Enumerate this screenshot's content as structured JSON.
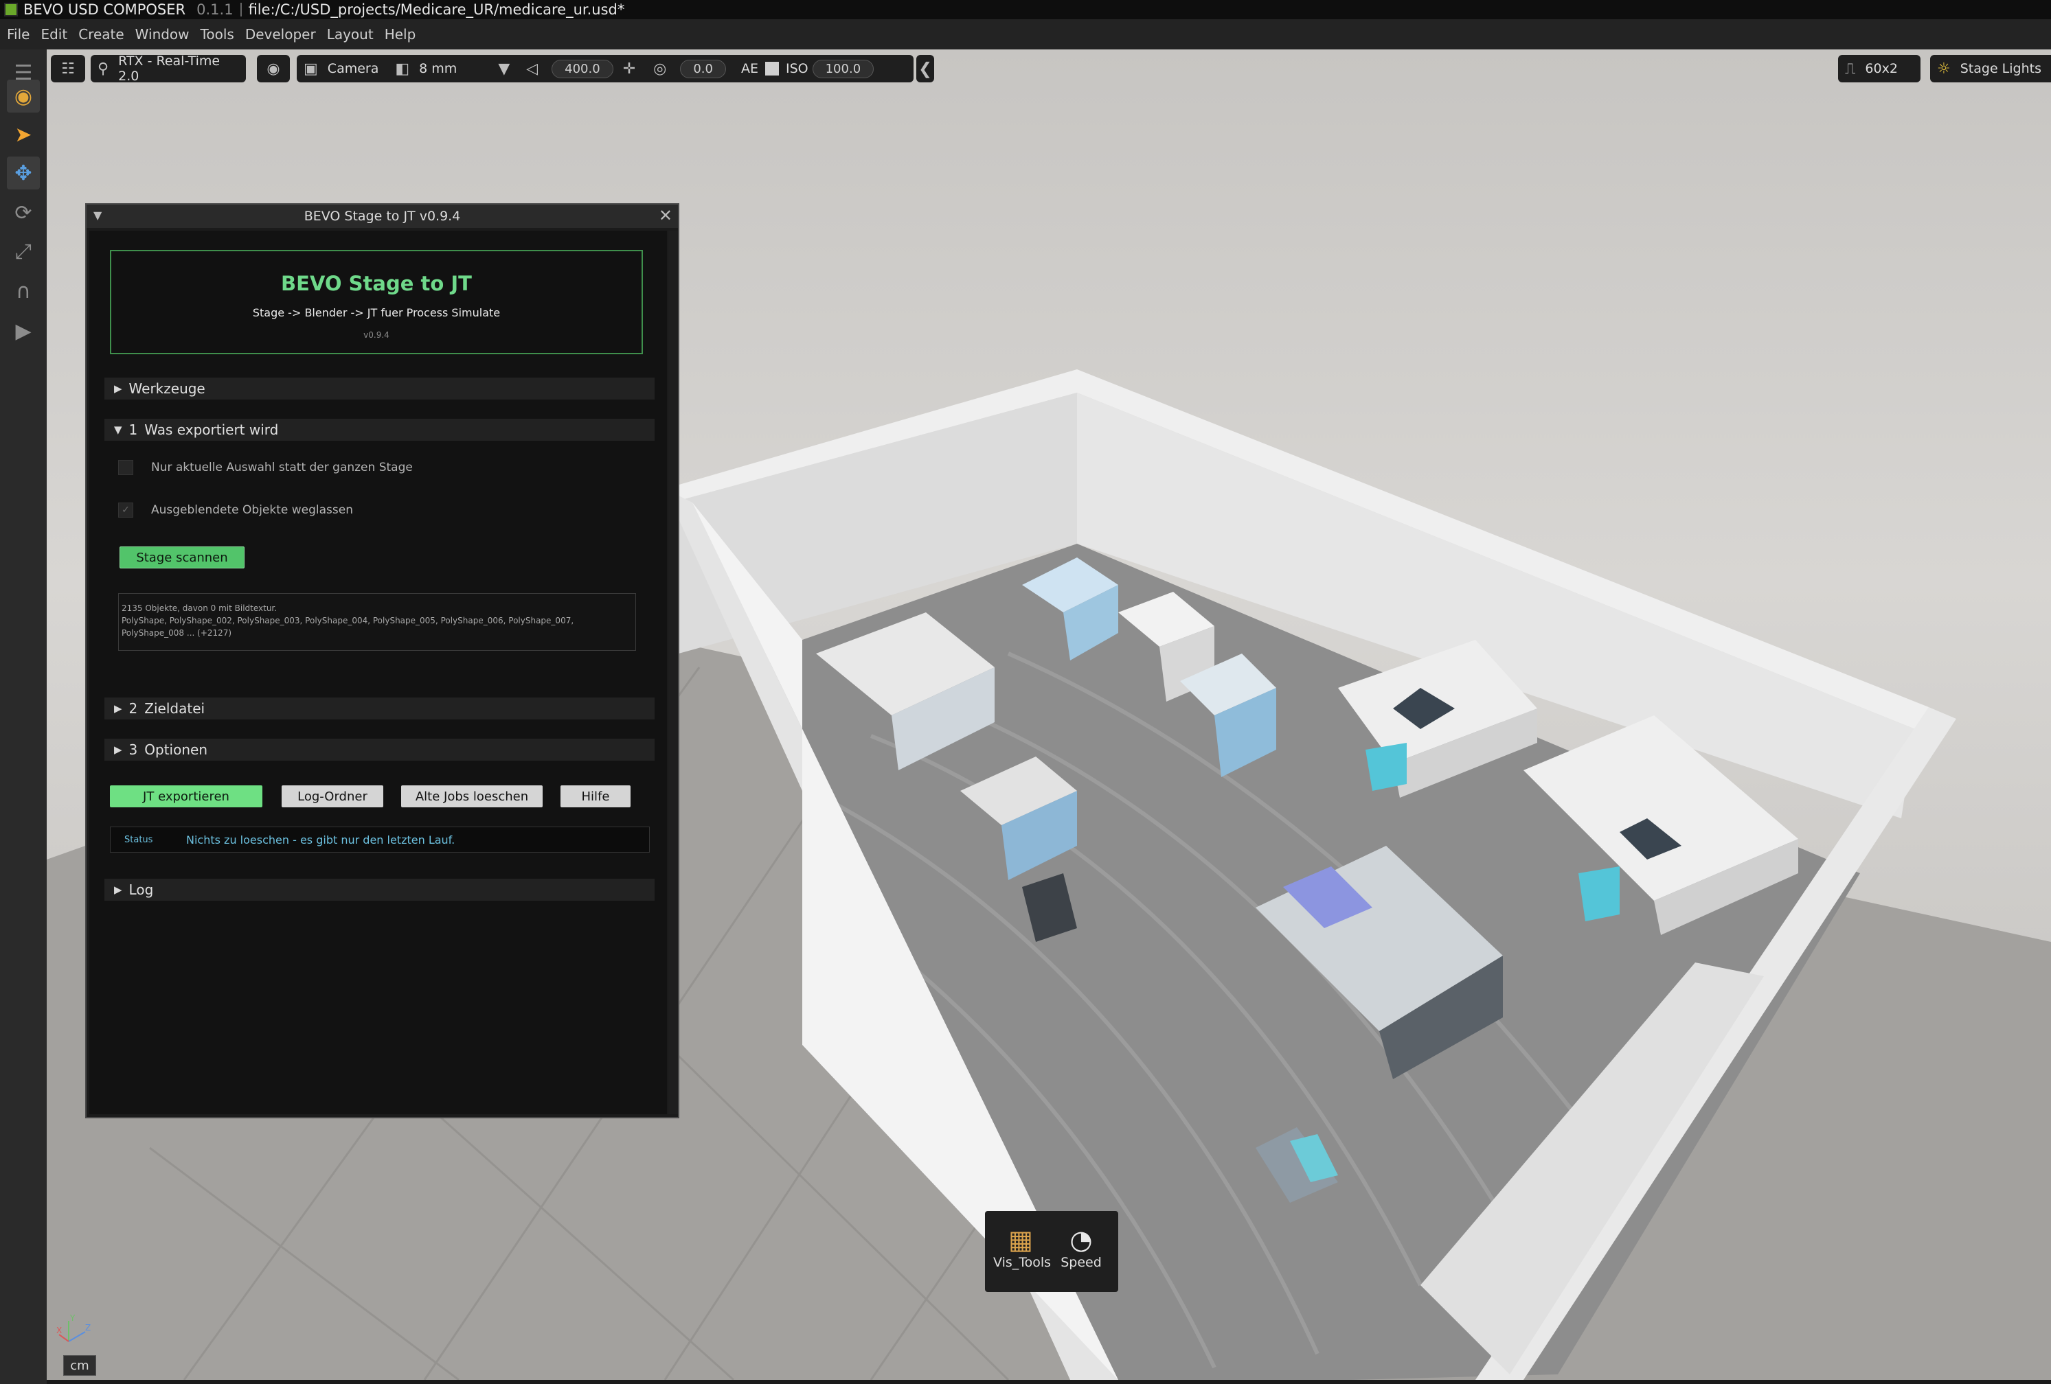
{
  "titlebar": {
    "app_name": "BEVO USD COMPOSER",
    "version": "0.1.1",
    "file_path": "file:/C:/USD_projects/Medicare_UR/medicare_ur.usd*"
  },
  "menu": [
    "File",
    "Edit",
    "Create",
    "Window",
    "Tools",
    "Developer",
    "Layout",
    "Help"
  ],
  "viewport_toolbar": {
    "renderer": "RTX - Real-Time 2.0",
    "camera": "Camera",
    "lens": "8 mm",
    "focus_distance": "400.0",
    "fstop": "0.0",
    "ae_label": "AE",
    "iso_label": "ISO",
    "iso_value": "100.0",
    "fps": "60x2",
    "lights": "Stage Lights"
  },
  "plugin": {
    "window_title": "BEVO Stage to JT v0.9.4",
    "header_title": "BEVO Stage to JT",
    "header_subtitle": "Stage -> Blender -> JT fuer Process Simulate",
    "header_version": "v0.9.4",
    "sections": {
      "tools": "Werkzeuge",
      "export_num": "1",
      "export": "Was exportiert wird",
      "target_num": "2",
      "target": "Zieldatei",
      "options_num": "3",
      "options": "Optionen",
      "log": "Log"
    },
    "checkbox_selection": "Nur aktuelle Auswahl statt der ganzen Stage",
    "checkbox_hidden": "Ausgeblendete Objekte weglassen",
    "scan_button": "Stage scannen",
    "scan_result_line1": "2135 Objekte, davon 0 mit Bildtextur.",
    "scan_result_line2": "PolyShape, PolyShape_002, PolyShape_003, PolyShape_004, PolyShape_005, PolyShape_006, PolyShape_007,",
    "scan_result_line3": "PolyShape_008 ... (+2127)",
    "buttons": {
      "export": "JT exportieren",
      "log_folder": "Log-Ordner",
      "delete_jobs": "Alte Jobs loeschen",
      "help": "Hilfe"
    },
    "status_label": "Status",
    "status_text": "Nichts zu loeschen - es gibt nur den letzten Lauf."
  },
  "dock": {
    "item1": "Vis_Tools",
    "item2": "Speed"
  },
  "unit": "cm",
  "axis": {
    "x": "X",
    "y": "Y",
    "z": "Z"
  }
}
